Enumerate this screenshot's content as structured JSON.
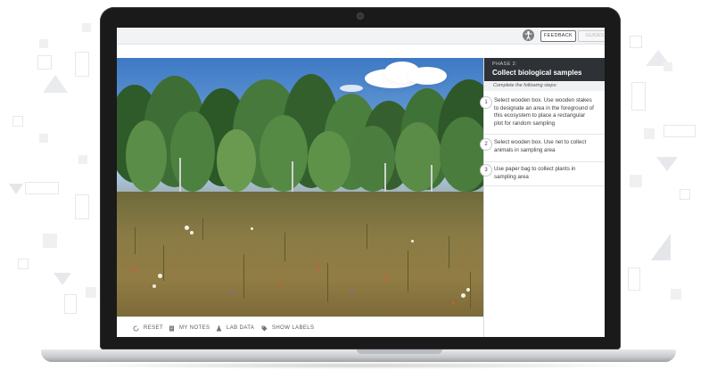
{
  "topbar": {
    "accessibility_icon": "accessibility-person-icon",
    "feedback_label": "FEEDBACK",
    "second_button_label": "GUIDES"
  },
  "toolbar": {
    "reset_label": "RESET",
    "notes_label": "MY NOTES",
    "lab_data_label": "LAB DATA",
    "show_labels_label": "SHOW LABELS",
    "icons": [
      "reset-icon",
      "notes-icon",
      "flask-icon",
      "tag-icon"
    ]
  },
  "panel": {
    "phase_label": "PHASE 2:",
    "phase_title": "Collect biological samples",
    "instructions": "Complete the following steps:",
    "steps": [
      {
        "number": "1",
        "lines": [
          "Select wooden box. Use wooden stakes",
          "to designate an area in the foreground of",
          "this ecosystem to place a rectangular",
          "plot for random sampling"
        ]
      },
      {
        "number": "2",
        "lines": [
          "Select wooden box. Use net to collect",
          "animals in sampling area"
        ]
      },
      {
        "number": "3",
        "lines": [
          "Use paper bag to collect plants in",
          "sampling area"
        ]
      }
    ]
  },
  "colors": {
    "panel_header_bg": "#2e3135",
    "sky": "#3d79c4",
    "grass": "#8a7b45",
    "laptop_bezel": "#1a1a1a"
  }
}
